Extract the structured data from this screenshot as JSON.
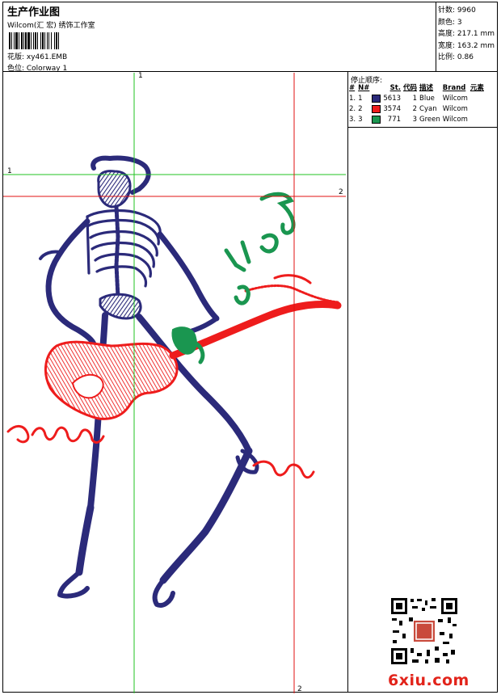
{
  "header": {
    "title": "生产作业图",
    "company": "Wilcom(汇 宏) 绣饰工作室",
    "design": "花版:  xy461.EMB",
    "colorway": "色位:  Colorway 1"
  },
  "stats": [
    "针数: 9960",
    "颜色: 3",
    "高度: 217.1 mm",
    "宽度: 163.2 mm",
    "比例: 0.86"
  ],
  "stop_sequence": {
    "title": "停止顺序:",
    "columns": [
      "#",
      "N#",
      "St.",
      "代码",
      "描述",
      "Brand",
      "元素"
    ],
    "rows": [
      {
        "num": "1.",
        "n": "1",
        "stitches": "5613",
        "code": "1",
        "desc": "Blue",
        "brand": "Wilcom",
        "color": "#2b2a7a"
      },
      {
        "num": "2.",
        "n": "2",
        "stitches": "3574",
        "code": "2",
        "desc": "Cyan",
        "brand": "Wilcom",
        "color": "#ee1c1c"
      },
      {
        "num": "3.",
        "n": "3",
        "stitches": "771",
        "code": "3",
        "desc": "Green",
        "brand": "Wilcom",
        "color": "#1a9650"
      }
    ]
  },
  "guides": {
    "green_v_label": "1",
    "green_h_label": "1",
    "red_h_label": "2",
    "red_v_label": "2"
  },
  "watermark": "6xiu.com",
  "colors": {
    "thread_blue": "#2b2a7a",
    "thread_red": "#ee1c1c",
    "thread_green": "#1a9650",
    "guide_green": "#22c322",
    "guide_red": "#e01010"
  }
}
